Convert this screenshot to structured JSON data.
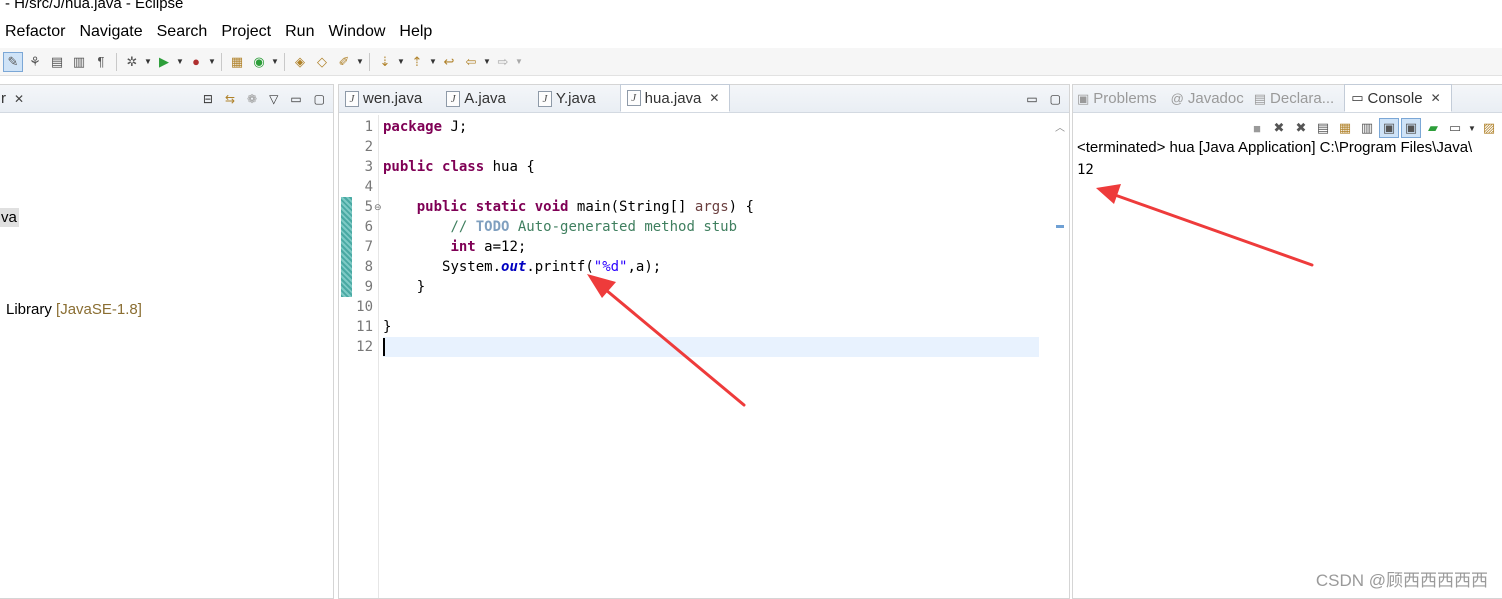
{
  "window": {
    "title": "- H/src/J/hua.java - Eclipse"
  },
  "menu": [
    "Refactor",
    "Navigate",
    "Search",
    "Project",
    "Run",
    "Window",
    "Help"
  ],
  "explorer": {
    "tab_close": "✕",
    "selected_item_fragment": "va",
    "library_label": "Library",
    "library_tag": "[JavaSE-1.8]"
  },
  "editor": {
    "tabs": [
      {
        "label": "wen.java",
        "selected": false
      },
      {
        "label": "A.java",
        "selected": false
      },
      {
        "label": "Y.java",
        "selected": false
      },
      {
        "label": "hua.java",
        "selected": true
      }
    ],
    "line_numbers": [
      "1",
      "2",
      "3",
      "4",
      "5",
      "6",
      "7",
      "8",
      "9",
      "10",
      "11",
      "12"
    ],
    "code": {
      "l1_kw": "package",
      "l1_rest": " J;",
      "l3_kw1": "public",
      "l3_kw2": "class",
      "l3_rest": " hua {",
      "l5_indent": "    ",
      "l5_kw1": "public",
      "l5_kw2": "static",
      "l5_kw3": "void",
      "l5_mid": " main(String[] ",
      "l5_param": "args",
      "l5_end": ") {",
      "l6_indent": "        ",
      "l6_cmt1": "// ",
      "l6_todo": "TODO",
      "l6_cmt2": " Auto-generated method stub",
      "l7_indent": "        ",
      "l7_kw": "int",
      "l7_rest": " a=12;",
      "l8_indent": "       ",
      "l8_a": "System.",
      "l8_field": "out",
      "l8_b": ".printf(",
      "l8_str": "\"%d\"",
      "l8_c": ",a);",
      "l9_text": "    }",
      "l11_text": "}"
    }
  },
  "console": {
    "tabs": [
      {
        "label": "Problems",
        "icon": "problems-icon"
      },
      {
        "label": "Javadoc",
        "icon": "javadoc-icon"
      },
      {
        "label": "Declara...",
        "icon": "declaration-icon"
      },
      {
        "label": "Console",
        "icon": "console-icon",
        "selected": true
      }
    ],
    "header": "<terminated> hua [Java Application] C:\\Program Files\\Java\\",
    "output": "12"
  },
  "watermark": "CSDN @顾西西西西西",
  "colors": {
    "annotation_arrow": "#ee3b3b",
    "keyword": "#7f0055",
    "comment": "#3f7f5f",
    "string": "#2a00ff"
  }
}
